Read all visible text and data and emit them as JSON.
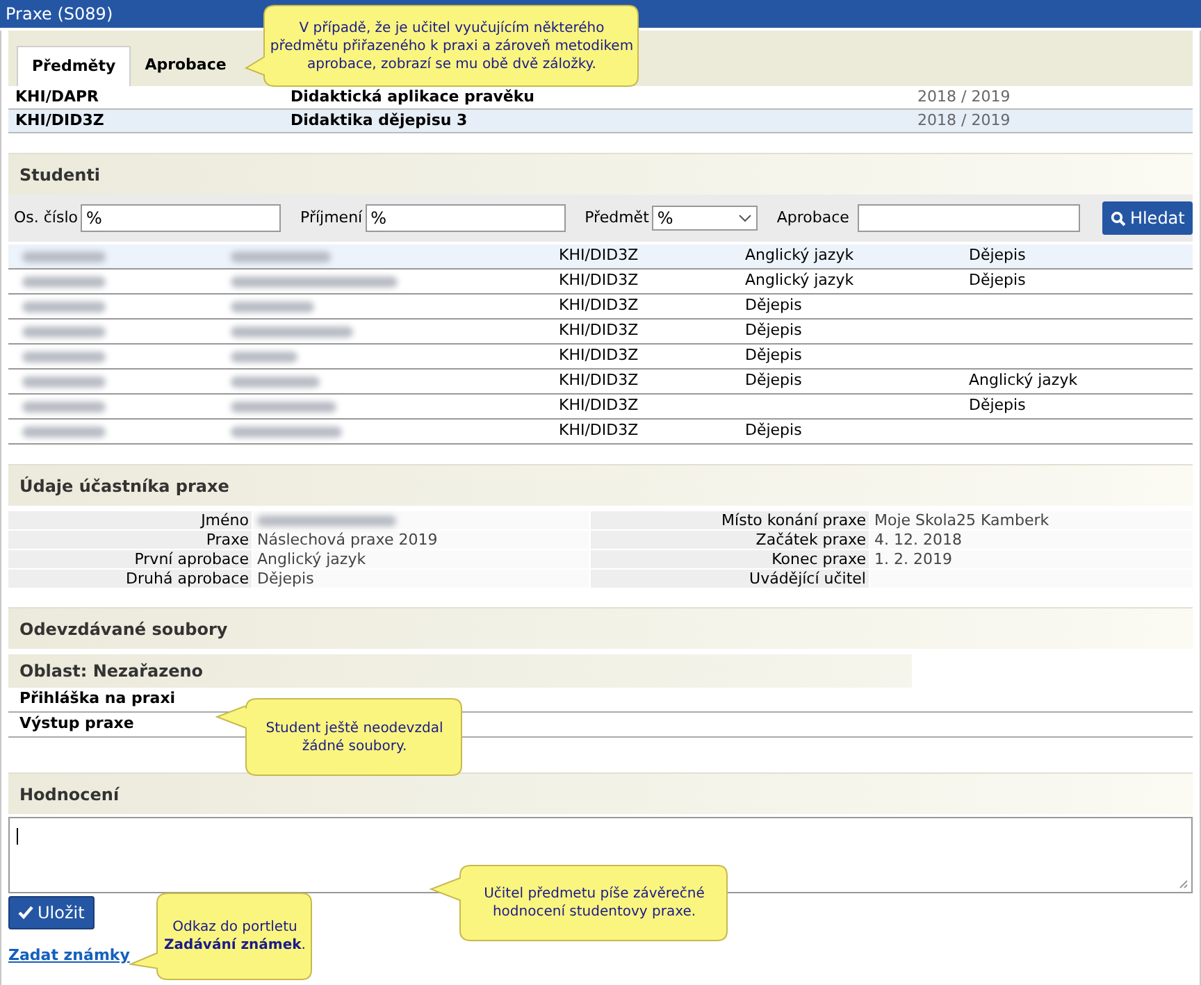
{
  "window": {
    "title": "Praxe (S089)"
  },
  "tabs": [
    {
      "label": "Předměty",
      "selected": true
    },
    {
      "label": "Aprobace",
      "selected": false
    }
  ],
  "subjects": [
    {
      "code": "KHI/DAPR",
      "name": "Didaktická aplikace pravěku",
      "year": "2018 / 2019",
      "selected": false
    },
    {
      "code": "KHI/DID3Z",
      "name": "Didaktika dějepisu 3",
      "year": "2018 / 2019",
      "selected": true
    }
  ],
  "students": {
    "title": "Studenti",
    "filters": [
      {
        "kind": "text",
        "label": "Os. číslo",
        "value": "%"
      },
      {
        "kind": "text",
        "label": "Příjmení",
        "value": "%"
      },
      {
        "kind": "select",
        "label": "Předmět",
        "value": "%"
      },
      {
        "kind": "text",
        "label": "Aprobace"
      }
    ],
    "search_button": "Hledat",
    "rows": [
      {
        "column_3": "KHI/DID3Z",
        "column_4": "Anglický jazyk",
        "column_5": "Dějepis",
        "selected": true
      },
      {
        "column_3": "KHI/DID3Z",
        "column_4": "Anglický jazyk",
        "column_5": "Dějepis",
        "selected": false
      },
      {
        "column_3": "KHI/DID3Z",
        "column_4": "Dějepis",
        "selected": false
      },
      {
        "column_3": "KHI/DID3Z",
        "column_4": "Dějepis",
        "selected": false
      },
      {
        "column_3": "KHI/DID3Z",
        "column_4": "Dějepis",
        "selected": false
      },
      {
        "column_3": "KHI/DID3Z",
        "column_4": "Dějepis",
        "column_5": "Anglický jazyk",
        "selected": false
      },
      {
        "column_3": "KHI/DID3Z",
        "column_5": "Dějepis",
        "selected": false
      },
      {
        "column_3": "KHI/DID3Z",
        "column_4": "Dějepis",
        "selected": false
      }
    ]
  },
  "participant": {
    "title": "Údaje účastníka praxe",
    "left": [
      {
        "label": "Jméno"
      },
      {
        "label": "Praxe",
        "value": "Náslechová praxe 2019"
      },
      {
        "label": "První aprobace",
        "value": "Anglický jazyk"
      },
      {
        "label": "Druhá aprobace",
        "value": "Dějepis"
      }
    ],
    "right": [
      {
        "label": "Místo konání praxe",
        "value": "Moje Skola25 Kamberk"
      },
      {
        "label": "Začátek praxe",
        "value": "4. 12. 2018"
      },
      {
        "label": "Konec praxe",
        "value": "1. 2. 2019"
      },
      {
        "label": "Uvádějící učitel"
      }
    ]
  },
  "files": {
    "title": "Odevzdávané soubory",
    "area": "Oblast: Nezařazeno",
    "items": [
      "Přihláška na praxi",
      "Výstup praxe"
    ]
  },
  "evaluation": {
    "title": "Hodnocení",
    "save_button": "Uložit",
    "link": "Zadat známky"
  },
  "callouts": [
    "V případě, že je učitel vyučujícím některého předmětu přiřazeného k praxi a zároveň metodikem aprobace, zobrazí se mu obě dvě záložky.",
    "Student ještě neodevzdal žádné soubory.",
    "Učitel předmetu píše závěrečné hodnocení studentovy praxe.",
    "Odkaz do portletu **Zadávání známek**."
  ]
}
